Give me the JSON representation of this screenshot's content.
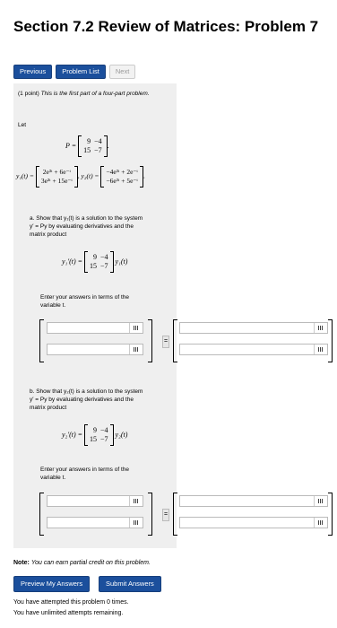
{
  "page": {
    "title": "Section 7.2 Review of Matrices: Problem 7"
  },
  "nav": {
    "previous": "Previous",
    "problem_list": "Problem List",
    "next": "Next"
  },
  "problem": {
    "intro_points": "(1 point)",
    "intro_text": "This is the first part of a four-part problem.",
    "let_label": "Let",
    "P_label": "P =",
    "P_matrix": [
      [
        "9",
        "−4"
      ],
      [
        "15",
        "−7"
      ]
    ],
    "y1_label": "y₁(t) =",
    "y1_vector": [
      "2e³ᵗ + 6e⁻ᵗ",
      "3e³ᵗ + 15e⁻ᵗ"
    ],
    "y2_label": "y₂(t) =",
    "y2_vector": [
      "−4e³ᵗ + 2e⁻ᵗ",
      "−6e³ᵗ + 5e⁻ᵗ"
    ],
    "part_a": {
      "text": "a. Show that y₁(t) is a solution to the system y′ = Py by evaluating derivatives and the matrix product",
      "lhs": "y₁′(t) =",
      "rhs": "y₁(t)",
      "enter": "Enter your answers in terms of the variable t."
    },
    "part_b": {
      "text": "b. Show that y₂(t) is a solution to the system y′ = Py by evaluating derivatives and the matrix product",
      "lhs": "y₂′(t) =",
      "rhs": "y₂(t)",
      "enter": "Enter your answers in terms of the variable t."
    },
    "equals": "="
  },
  "note_label": "Note:",
  "note_text": "You can earn partial credit on this problem.",
  "actions": {
    "preview": "Preview My Answers",
    "submit": "Submit Answers"
  },
  "status": {
    "attempted": "You have attempted this problem 0 times.",
    "remaining": "You have unlimited attempts remaining."
  }
}
